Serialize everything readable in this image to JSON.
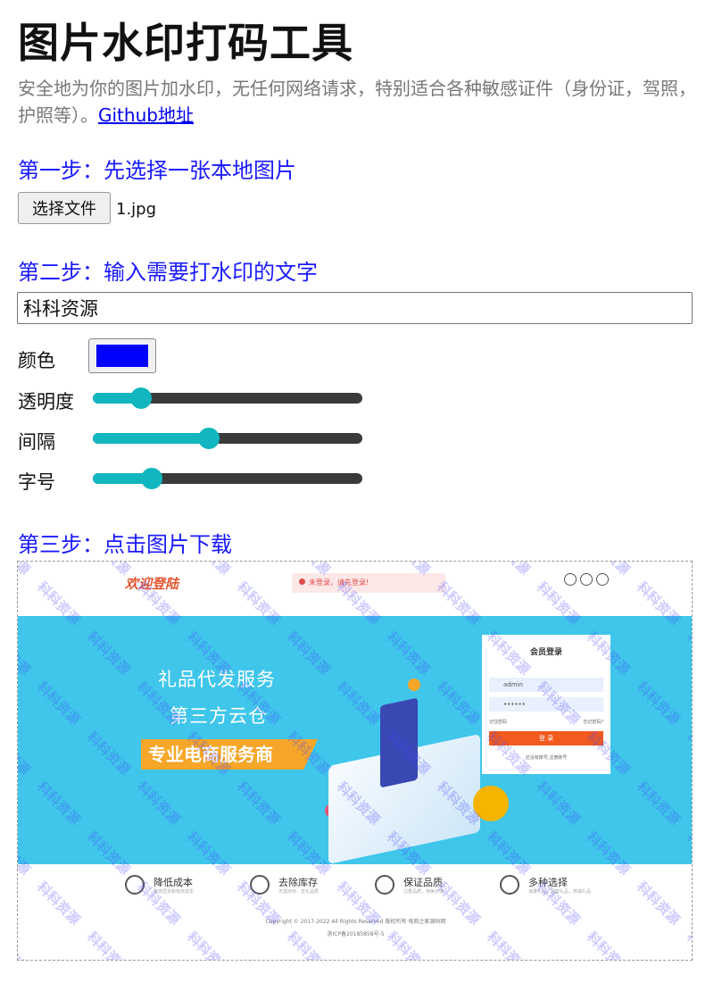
{
  "page": {
    "title": "图片水印打码工具",
    "subtitle": "安全地为你的图片加水印，无任何网络请求，特别适合各种敏感证件（身份证，驾照，护照等）。",
    "github_link": "Github地址"
  },
  "step1": {
    "heading": "第一步：先选择一张本地图片",
    "file_button": "选择文件",
    "file_name": "1.jpg"
  },
  "step2": {
    "heading": "第二步：输入需要打水印的文字",
    "watermark_text": "科科资源",
    "color_label": "颜色",
    "color_value": "#0000ff",
    "opacity_label": "透明度",
    "opacity_fraction": 0.18,
    "spacing_label": "间隔",
    "spacing_fraction": 0.43,
    "fontsize_label": "字号",
    "fontsize_fraction": 0.22
  },
  "step3": {
    "heading": "第三步：点击图片下载"
  },
  "preview": {
    "logo": "欢迎登陆",
    "alert": "未登录，请先登录!",
    "banner_line1": "礼品代发服务",
    "banner_line2": "第三方云仓",
    "banner_tag": "专业电商服务商",
    "login_title": "会员登录",
    "login_user": "admin",
    "login_pass": "••••••",
    "remember": "记住密码",
    "forgot": "忘记密码?",
    "login_button": "登 录",
    "register": "还没有账号,注册账号",
    "features": [
      {
        "title": "降低成本",
        "desc": "降低囤货和物流成本"
      },
      {
        "title": "去除库存",
        "desc": "无需库存，去化品质"
      },
      {
        "title": "保证品质",
        "desc": "注重品质，物美价廉"
      },
      {
        "title": "多种选择",
        "desc": "海量礼品，配套礼品，高端礼品"
      }
    ],
    "copyright": "Copyright © 2017-2022 All Rights Reserved 版权所有 电商之家源码网",
    "icp": "浙ICP备20185858号-5"
  },
  "colors": {
    "heading": "#1a1aff",
    "slider_active": "#11b6bf",
    "slider_track": "#3a3a3a",
    "banner": "#3fc6ea"
  }
}
